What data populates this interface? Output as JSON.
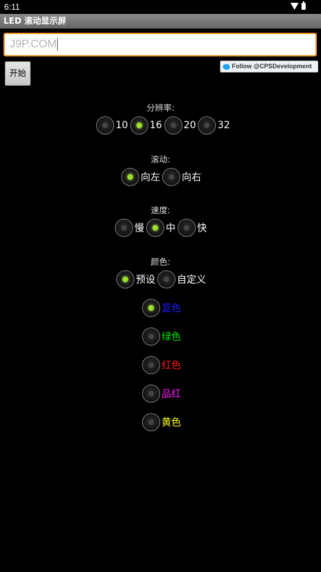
{
  "status_bar": {
    "time": "6:11",
    "icons": [
      "wifi-icon",
      "battery-icon"
    ]
  },
  "title_bar": {
    "title": "LED 滚动显示屏"
  },
  "text_input": {
    "value": "J9P.COM"
  },
  "start_button": {
    "label": "开始"
  },
  "follow_button": {
    "label": "Follow @CPSDevelopment"
  },
  "resolution": {
    "label": "分辨率:",
    "options": [
      {
        "label": "10",
        "selected": false
      },
      {
        "label": "16",
        "selected": true
      },
      {
        "label": "20",
        "selected": false
      },
      {
        "label": "32",
        "selected": false
      }
    ]
  },
  "scroll": {
    "label": "滚动:",
    "options": [
      {
        "label": "向左",
        "selected": true
      },
      {
        "label": "向右",
        "selected": false
      }
    ]
  },
  "speed": {
    "label": "速度:",
    "options": [
      {
        "label": "慢",
        "selected": false
      },
      {
        "label": "中",
        "selected": true
      },
      {
        "label": "快",
        "selected": false
      }
    ]
  },
  "color": {
    "label": "颜色:",
    "options": [
      {
        "label": "预设",
        "selected": true
      },
      {
        "label": "自定义",
        "selected": false
      }
    ],
    "presets": [
      {
        "label": "蓝色",
        "color": "#1a1aff",
        "selected": true
      },
      {
        "label": "绿色",
        "color": "#00e600",
        "selected": false
      },
      {
        "label": "红色",
        "color": "#ff1a1a",
        "selected": false
      },
      {
        "label": "品红",
        "color": "#ff1aff",
        "selected": false
      },
      {
        "label": "黄色",
        "color": "#ffff1a",
        "selected": false
      }
    ]
  },
  "theme": {
    "accent": "#9be02c",
    "input_border": "#f29a2e"
  }
}
